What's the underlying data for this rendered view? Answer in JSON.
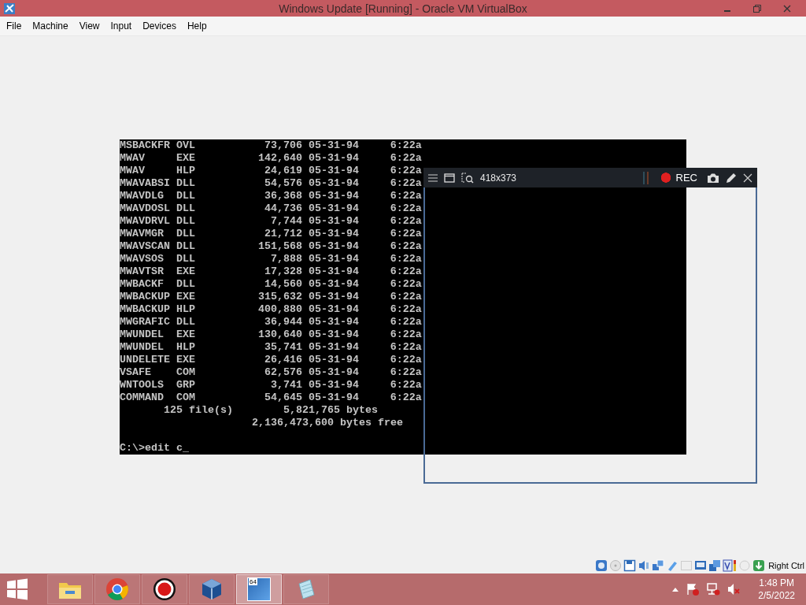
{
  "window": {
    "title": "Windows Update [Running] - Oracle VM VirtualBox"
  },
  "menu": [
    "File",
    "Machine",
    "View",
    "Input",
    "Devices",
    "Help"
  ],
  "console": {
    "files": [
      {
        "name": "MSBACKFR",
        "ext": "OVL",
        "size": "73,706",
        "date": "05-31-94",
        "time": "6:22a"
      },
      {
        "name": "MWAV",
        "ext": "EXE",
        "size": "142,640",
        "date": "05-31-94",
        "time": "6:22a"
      },
      {
        "name": "MWAV",
        "ext": "HLP",
        "size": "24,619",
        "date": "05-31-94",
        "time": "6:22a"
      },
      {
        "name": "MWAVABSI",
        "ext": "DLL",
        "size": "54,576",
        "date": "05-31-94",
        "time": "6:22a"
      },
      {
        "name": "MWAVDLG",
        "ext": "DLL",
        "size": "36,368",
        "date": "05-31-94",
        "time": "6:22a"
      },
      {
        "name": "MWAVDOSL",
        "ext": "DLL",
        "size": "44,736",
        "date": "05-31-94",
        "time": "6:22a"
      },
      {
        "name": "MWAVDRVL",
        "ext": "DLL",
        "size": "7,744",
        "date": "05-31-94",
        "time": "6:22a"
      },
      {
        "name": "MWAVMGR",
        "ext": "DLL",
        "size": "21,712",
        "date": "05-31-94",
        "time": "6:22a"
      },
      {
        "name": "MWAVSCAN",
        "ext": "DLL",
        "size": "151,568",
        "date": "05-31-94",
        "time": "6:22a"
      },
      {
        "name": "MWAVSOS",
        "ext": "DLL",
        "size": "7,888",
        "date": "05-31-94",
        "time": "6:22a"
      },
      {
        "name": "MWAVTSR",
        "ext": "EXE",
        "size": "17,328",
        "date": "05-31-94",
        "time": "6:22a"
      },
      {
        "name": "MWBACKF",
        "ext": "DLL",
        "size": "14,560",
        "date": "05-31-94",
        "time": "6:22a"
      },
      {
        "name": "MWBACKUP",
        "ext": "EXE",
        "size": "315,632",
        "date": "05-31-94",
        "time": "6:22a"
      },
      {
        "name": "MWBACKUP",
        "ext": "HLP",
        "size": "400,880",
        "date": "05-31-94",
        "time": "6:22a"
      },
      {
        "name": "MWGRAFIC",
        "ext": "DLL",
        "size": "36,944",
        "date": "05-31-94",
        "time": "6:22a"
      },
      {
        "name": "MWUNDEL",
        "ext": "EXE",
        "size": "130,640",
        "date": "05-31-94",
        "time": "6:22a"
      },
      {
        "name": "MWUNDEL",
        "ext": "HLP",
        "size": "35,741",
        "date": "05-31-94",
        "time": "6:22a"
      },
      {
        "name": "UNDELETE",
        "ext": "EXE",
        "size": "26,416",
        "date": "05-31-94",
        "time": "6:22a"
      },
      {
        "name": "VSAFE",
        "ext": "COM",
        "size": "62,576",
        "date": "05-31-94",
        "time": "6:22a"
      },
      {
        "name": "WNTOOLS",
        "ext": "GRP",
        "size": "3,741",
        "date": "05-31-94",
        "time": "6:22a"
      },
      {
        "name": "COMMAND",
        "ext": "COM",
        "size": "54,645",
        "date": "05-31-94",
        "time": "6:22a"
      }
    ],
    "summary": {
      "file_count": "125 file(s)",
      "total_size": "5,821,765 bytes",
      "free_space": "2,136,473,600 bytes free"
    },
    "prompt": "C:\\>edit c",
    "cursor": "_"
  },
  "recorder": {
    "size": "418x373",
    "rec_label": "REC"
  },
  "status_bar": {
    "host_key": "Right Ctrl"
  },
  "taskbar": {
    "apps": [
      {
        "kind": "explorer",
        "selected": false
      },
      {
        "kind": "chrome",
        "selected": false
      },
      {
        "kind": "recorder",
        "selected": false
      },
      {
        "kind": "virtualbox",
        "selected": false
      },
      {
        "kind": "vm",
        "badge": "64",
        "selected": true
      },
      {
        "kind": "notepad",
        "selected": false
      }
    ],
    "clock": {
      "time": "1:48 PM",
      "date": "2/5/2022"
    }
  }
}
